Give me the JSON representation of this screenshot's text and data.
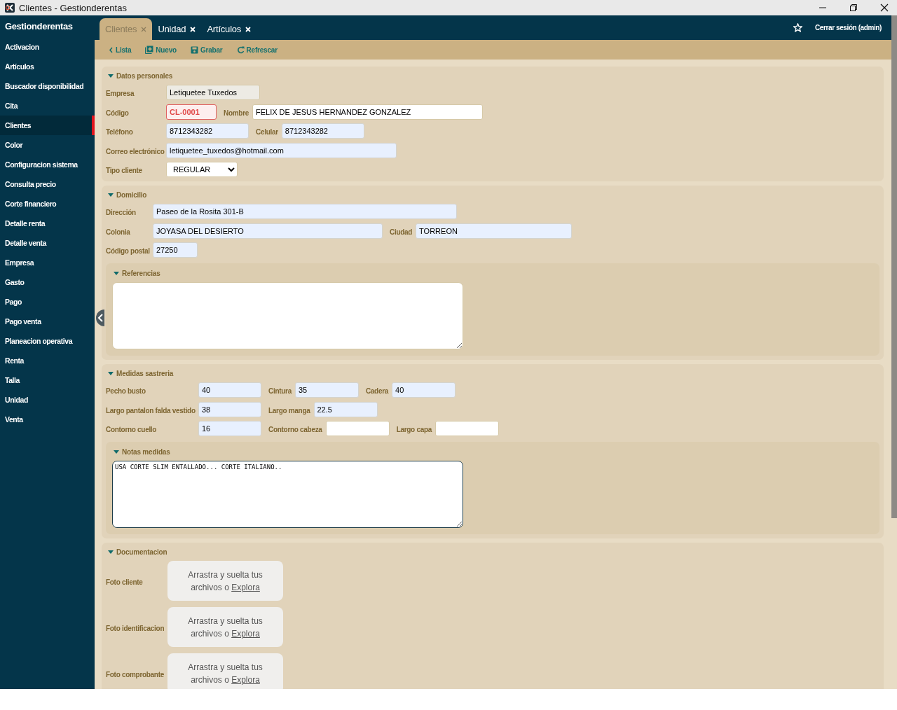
{
  "window": {
    "title": "Clientes - Gestionderentas"
  },
  "sidebar": {
    "title": "Gestionderentas",
    "items": [
      {
        "label": "Activacion",
        "selected": false
      },
      {
        "label": "Artículos",
        "selected": false
      },
      {
        "label": "Buscador disponibilidad",
        "selected": false
      },
      {
        "label": "Cita",
        "selected": false
      },
      {
        "label": "Clientes",
        "selected": true
      },
      {
        "label": "Color",
        "selected": false
      },
      {
        "label": "Configuracion sistema",
        "selected": false
      },
      {
        "label": "Consulta precio",
        "selected": false
      },
      {
        "label": "Corte financiero",
        "selected": false
      },
      {
        "label": "Detalle renta",
        "selected": false
      },
      {
        "label": "Detalle venta",
        "selected": false
      },
      {
        "label": "Empresa",
        "selected": false
      },
      {
        "label": "Gasto",
        "selected": false
      },
      {
        "label": "Pago",
        "selected": false
      },
      {
        "label": "Pago venta",
        "selected": false
      },
      {
        "label": "Planeacion operativa",
        "selected": false
      },
      {
        "label": "Renta",
        "selected": false
      },
      {
        "label": "Talla",
        "selected": false
      },
      {
        "label": "Unidad",
        "selected": false
      },
      {
        "label": "Venta",
        "selected": false
      }
    ]
  },
  "tabs": [
    {
      "label": "Clientes",
      "selected": true
    },
    {
      "label": "Unidad",
      "selected": false
    },
    {
      "label": "Artículos",
      "selected": false
    }
  ],
  "header": {
    "logout": "Cerrar sesión (admin)"
  },
  "toolbar": [
    {
      "label": "Lista",
      "kind": "back"
    },
    {
      "label": "Nuevo",
      "kind": "add"
    },
    {
      "label": "Grabar",
      "kind": "save"
    },
    {
      "label": "Refrescar",
      "kind": "refresh"
    }
  ],
  "sections": [
    {
      "title": "Datos personales",
      "kind": "fields",
      "rows": [
        [
          {
            "label": "Empresa",
            "value": "Letiquetee Tuxedos",
            "kind": "readonly"
          }
        ],
        [
          {
            "label": "Código",
            "value": "CL-0001",
            "kind": "error"
          },
          {
            "label": "Nombre",
            "value": "FELIX DE JESUS HERNANDEZ GONZALEZ",
            "kind": "text"
          }
        ],
        [
          {
            "label": "Teléfono",
            "value": "8712343282",
            "kind": "autofill"
          },
          {
            "label": "Celular",
            "value": "8712343282",
            "kind": "autofill"
          }
        ],
        [
          {
            "label": "Correo electrónico",
            "value": "letiquetee_tuxedos@hotmail.com",
            "kind": "autofill"
          }
        ],
        [
          {
            "label": "Tipo cliente",
            "value": "REGULAR",
            "kind": "select"
          }
        ]
      ]
    },
    {
      "title": "Domicilio",
      "kind": "fields",
      "rows": [
        [
          {
            "label": "Dirección",
            "value": "Paseo de la Rosita 301-B",
            "kind": "autofill"
          }
        ],
        [
          {
            "label": "Colonia",
            "value": "JOYASA DEL DESIERTO",
            "kind": "autofill"
          },
          {
            "label": "Ciudad",
            "value": "TORREON",
            "kind": "autofill"
          }
        ],
        [
          {
            "label": "Código postal",
            "value": "27250",
            "kind": "autofill"
          }
        ]
      ],
      "subsection": {
        "title": "Referencias",
        "textarea": {
          "focused": false
        }
      }
    },
    {
      "title": "Medidas sastreria",
      "kind": "fields",
      "rows": [
        [
          {
            "label": "Pecho busto",
            "value": "40",
            "kind": "autofill"
          },
          {
            "label": "Cintura",
            "value": "35",
            "kind": "autofill"
          },
          {
            "label": "Cadera",
            "value": "40",
            "kind": "autofill"
          }
        ],
        [
          {
            "label": "Largo pantalon falda vestido",
            "value": "38",
            "kind": "autofill"
          },
          {
            "label": "Largo manga",
            "value": "22.5",
            "kind": "autofill"
          }
        ],
        [
          {
            "label": "Contorno cuello",
            "value": "16",
            "kind": "autofill"
          },
          {
            "label": "Contorno cabeza",
            "kind": "text"
          },
          {
            "label": "Largo capa",
            "kind": "text"
          }
        ]
      ],
      "subsection": {
        "title": "Notas medidas",
        "textarea": {
          "value": "USA CORTE SLIM ENTALLADO... CORTE ITALIANO..",
          "focused": true
        }
      }
    },
    {
      "title": "Documentacion",
      "kind": "uploads",
      "uploads": [
        {
          "label": "Foto cliente",
          "prompt": "Arrastra y suelta tus archivos o",
          "link": "Explora"
        },
        {
          "label": "Foto identificacion",
          "prompt": "Arrastra y suelta tus archivos o",
          "link": "Explora"
        },
        {
          "label": "Foto comprobante",
          "prompt": "Arrastra y suelta tus archivos o",
          "link": "Explora"
        }
      ]
    }
  ]
}
